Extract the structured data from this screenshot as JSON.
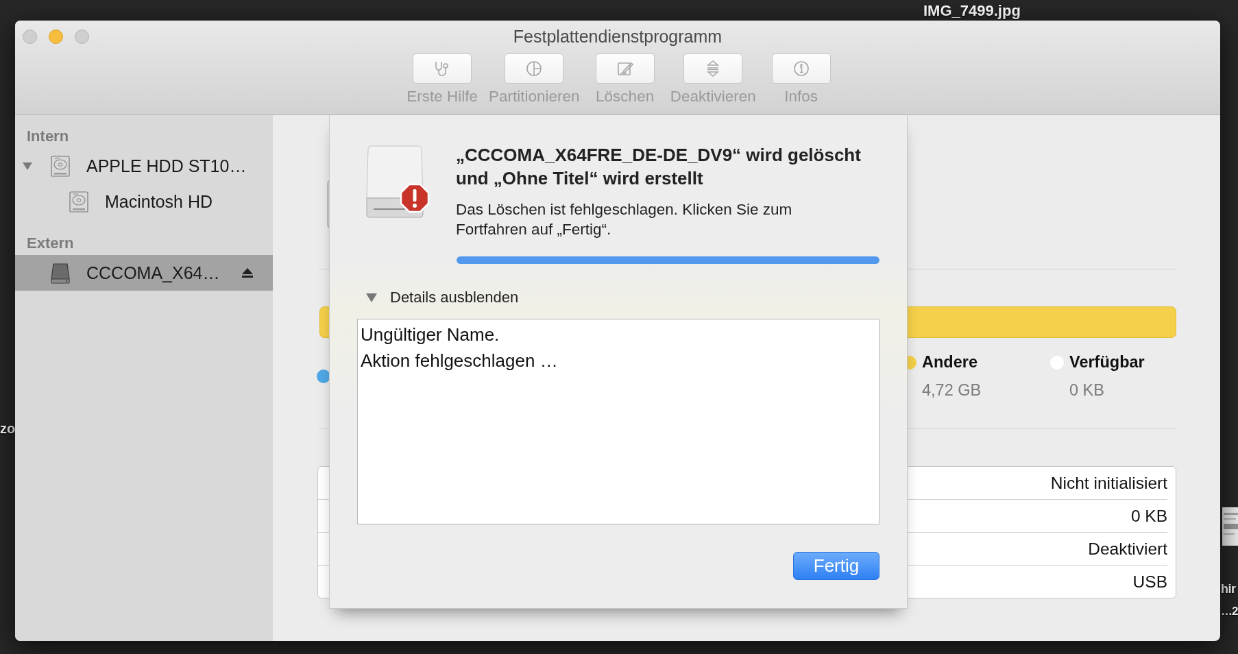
{
  "desktop_items": [
    {
      "label": "IMG_7499.jpg"
    },
    {
      "label": "zo"
    },
    {
      "label": "hir"
    },
    {
      "label": "…2"
    }
  ],
  "window": {
    "title": "Festplattendienstprogramm",
    "traffic_lights": [
      {
        "kind": "close",
        "disabled": true
      },
      {
        "kind": "minimize",
        "disabled": false
      },
      {
        "kind": "zoom",
        "disabled": true
      }
    ]
  },
  "toolbar": [
    {
      "kind": "first-aid",
      "label": "Erste Hilfe",
      "disabled": true
    },
    {
      "kind": "partition",
      "label": "Partitionieren",
      "disabled": true
    },
    {
      "kind": "erase",
      "label": "Löschen",
      "disabled": true
    },
    {
      "kind": "unmount",
      "label": "Deaktivieren",
      "disabled": true
    },
    {
      "kind": "info",
      "label": "Infos",
      "disabled": true
    }
  ],
  "sidebar": {
    "sections": [
      {
        "title": "Intern",
        "items": [
          {
            "kind": "internal",
            "label": "APPLE HDD ST10…",
            "selected": false,
            "expanded": true,
            "children": [
              {
                "kind": "internal",
                "label": "Macintosh HD",
                "selected": false
              }
            ]
          }
        ]
      },
      {
        "title": "Extern",
        "items": [
          {
            "kind": "external",
            "label": "CCCOMA_X64…",
            "selected": true,
            "ejectable": true
          }
        ]
      }
    ]
  },
  "main": {
    "usage_bar": {
      "level": 1
    },
    "legend": [
      {
        "color": "#4fa8e6"
      },
      {
        "label": "Andere",
        "value": "4,72 GB",
        "color": "#f5d04a"
      },
      {
        "label": "Verfügbar",
        "value": "0 KB",
        "color": "#ffffff"
      }
    ],
    "info_rows": [
      {
        "value": "Nicht initialisiert"
      },
      {
        "value": "0 KB"
      },
      {
        "value": "Deaktiviert"
      },
      {
        "value": "USB"
      }
    ]
  },
  "dialog": {
    "title": "„CCCOMA_X64FRE_DE-DE_DV9“ wird gelöscht und „Ohne Titel“ wird erstellt",
    "message": "Das Löschen ist fehlgeschlagen. Klicken Sie zum Fortfahren auf „Fertig“.",
    "progress": {
      "level": 1
    },
    "details": {
      "label": "Details ausblenden",
      "expanded": true,
      "lines": [
        "Ungültiger Name.",
        "Aktion fehlgeschlagen …"
      ]
    },
    "buttons": [
      {
        "label": "Fertig",
        "default": true
      }
    ]
  }
}
